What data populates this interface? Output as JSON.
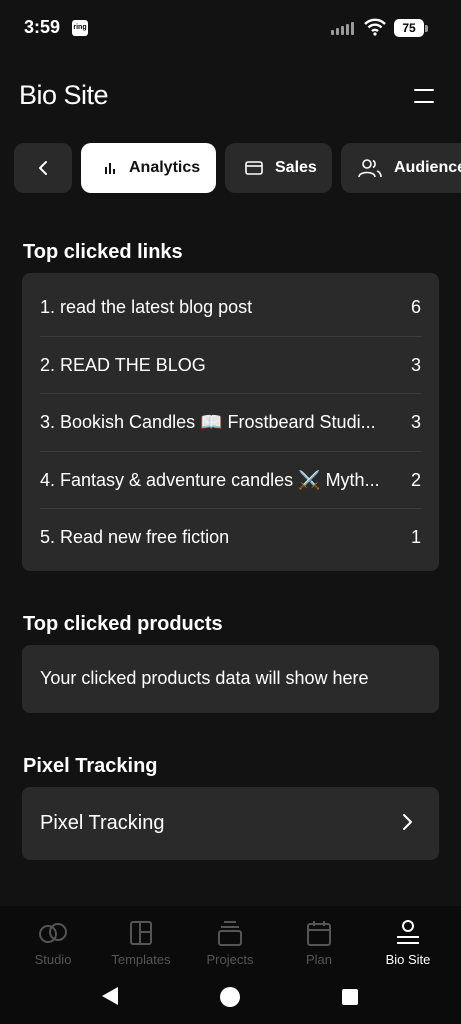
{
  "status_bar": {
    "time": "3:59",
    "notification_badge": "ring",
    "battery": "75"
  },
  "header": {
    "title": "Bio Site",
    "menu_icon": "hamburger-icon"
  },
  "tabs": [
    {
      "label": "",
      "icon": "chevron-left-icon"
    },
    {
      "label": "Analytics",
      "icon": "bar-chart-icon",
      "active": true
    },
    {
      "label": "Sales",
      "icon": "card-icon"
    },
    {
      "label": "Audience",
      "icon": "users-icon"
    }
  ],
  "top_links": {
    "title": "Top clicked links",
    "rows": [
      {
        "label": "1. read the latest blog post",
        "count": "6"
      },
      {
        "label": "2. READ THE BLOG",
        "count": "3"
      },
      {
        "label": "3. Bookish Candles 📖 Frostbeard Studi...",
        "count": "3"
      },
      {
        "label": "4. Fantasy & adventure candles ⚔️ Myth...",
        "count": "2"
      },
      {
        "label": "5. Read new free fiction",
        "count": "1"
      }
    ]
  },
  "top_products": {
    "title": "Top clicked products",
    "empty_message": "Your clicked products data will show here"
  },
  "pixel_tracking": {
    "title": "Pixel Tracking",
    "row_label": "Pixel Tracking"
  },
  "bottom_nav": [
    {
      "label": "Studio",
      "icon": "studio-icon"
    },
    {
      "label": "Templates",
      "icon": "templates-icon"
    },
    {
      "label": "Projects",
      "icon": "projects-icon"
    },
    {
      "label": "Plan",
      "icon": "calendar-icon"
    },
    {
      "label": "Bio Site",
      "icon": "bio-site-icon",
      "active": true
    }
  ],
  "colors": {
    "background": "#121212",
    "card": "#2a2a2a",
    "active_tab": "#ffffff",
    "inactive_nav": "#555555"
  }
}
